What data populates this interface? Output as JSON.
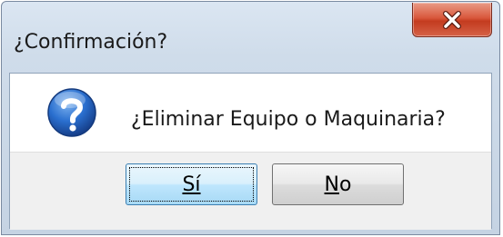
{
  "dialog": {
    "title": "¿Confirmación?",
    "message": "¿Eliminar Equipo o Maquinaria?",
    "icon": "question-icon",
    "buttons": {
      "yes_label": "Sí",
      "no_label": "No"
    },
    "colors": {
      "close_button": "#c43b1f",
      "icon_blue": "#1f5fb8",
      "default_button_border": "#3c7fb1"
    }
  }
}
